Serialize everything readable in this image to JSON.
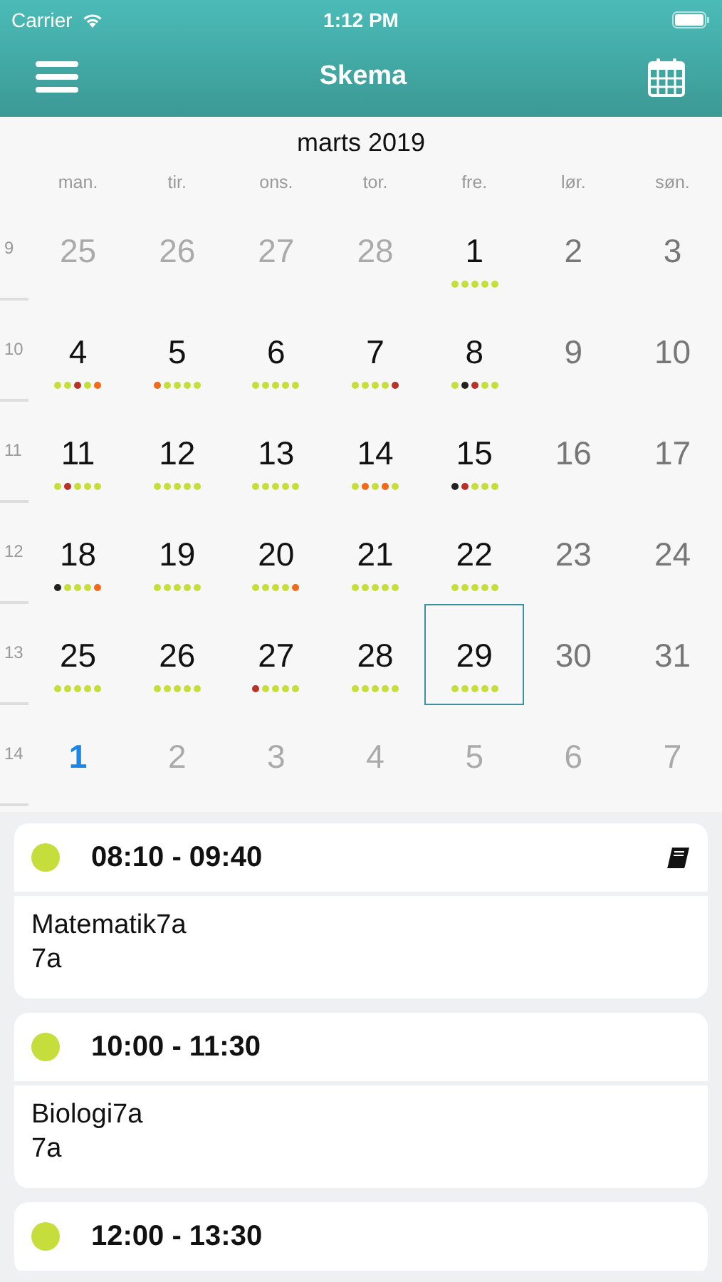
{
  "status_bar": {
    "carrier": "Carrier",
    "time": "1:12 PM"
  },
  "nav": {
    "title": "Skema"
  },
  "calendar": {
    "month": "marts 2019",
    "weekdays": [
      "man.",
      "tir.",
      "ons.",
      "tor.",
      "fre.",
      "lør.",
      "søn."
    ],
    "weeks": [
      {
        "number": "9",
        "days": [
          {
            "label": "25",
            "kind": "outside",
            "selected": false
          },
          {
            "label": "26",
            "kind": "outside",
            "selected": false
          },
          {
            "label": "27",
            "kind": "outside",
            "selected": false
          },
          {
            "label": "28",
            "kind": "outside",
            "selected": false
          },
          {
            "label": "1",
            "kind": "weekday",
            "selected": false,
            "dots": [
              {
                "color": "#c6de3c"
              },
              {
                "color": "#c6de3c"
              },
              {
                "color": "#c6de3c"
              },
              {
                "color": "#c6de3c"
              },
              {
                "color": "#c6de3c"
              }
            ]
          },
          {
            "label": "2",
            "kind": "weekend",
            "selected": false
          },
          {
            "label": "3",
            "kind": "weekend",
            "selected": false
          }
        ]
      },
      {
        "number": "10",
        "days": [
          {
            "label": "4",
            "kind": "weekday",
            "selected": false,
            "dots": [
              {
                "color": "#c6de3c"
              },
              {
                "color": "#c6de3c"
              },
              {
                "color": "#b8322a"
              },
              {
                "color": "#c6de3c"
              },
              {
                "color": "#f06a1c"
              }
            ]
          },
          {
            "label": "5",
            "kind": "weekday",
            "selected": false,
            "dots": [
              {
                "color": "#f06a1c"
              },
              {
                "color": "#c6de3c"
              },
              {
                "color": "#c6de3c"
              },
              {
                "color": "#c6de3c"
              },
              {
                "color": "#c6de3c"
              }
            ]
          },
          {
            "label": "6",
            "kind": "weekday",
            "selected": false,
            "dots": [
              {
                "color": "#c6de3c"
              },
              {
                "color": "#c6de3c"
              },
              {
                "color": "#c6de3c"
              },
              {
                "color": "#c6de3c"
              },
              {
                "color": "#c6de3c"
              }
            ]
          },
          {
            "label": "7",
            "kind": "weekday",
            "selected": false,
            "dots": [
              {
                "color": "#c6de3c"
              },
              {
                "color": "#c6de3c"
              },
              {
                "color": "#c6de3c"
              },
              {
                "color": "#c6de3c"
              },
              {
                "color": "#b8322a"
              }
            ]
          },
          {
            "label": "8",
            "kind": "weekday",
            "selected": false,
            "dots": [
              {
                "color": "#c6de3c"
              },
              {
                "color": "#222222"
              },
              {
                "color": "#b8322a"
              },
              {
                "color": "#c6de3c"
              },
              {
                "color": "#c6de3c"
              }
            ]
          },
          {
            "label": "9",
            "kind": "weekend",
            "selected": false
          },
          {
            "label": "10",
            "kind": "weekend",
            "selected": false
          }
        ]
      },
      {
        "number": "11",
        "days": [
          {
            "label": "11",
            "kind": "weekday",
            "selected": false,
            "dots": [
              {
                "color": "#c6de3c"
              },
              {
                "color": "#b8322a"
              },
              {
                "color": "#c6de3c"
              },
              {
                "color": "#c6de3c"
              },
              {
                "color": "#c6de3c"
              }
            ]
          },
          {
            "label": "12",
            "kind": "weekday",
            "selected": false,
            "dots": [
              {
                "color": "#c6de3c"
              },
              {
                "color": "#c6de3c"
              },
              {
                "color": "#c6de3c"
              },
              {
                "color": "#c6de3c"
              },
              {
                "color": "#c6de3c"
              }
            ]
          },
          {
            "label": "13",
            "kind": "weekday",
            "selected": false,
            "dots": [
              {
                "color": "#c6de3c"
              },
              {
                "color": "#c6de3c"
              },
              {
                "color": "#c6de3c"
              },
              {
                "color": "#c6de3c"
              },
              {
                "color": "#c6de3c"
              }
            ]
          },
          {
            "label": "14",
            "kind": "weekday",
            "selected": false,
            "dots": [
              {
                "color": "#c6de3c"
              },
              {
                "color": "#f06a1c"
              },
              {
                "color": "#c6de3c"
              },
              {
                "color": "#f06a1c"
              },
              {
                "color": "#c6de3c"
              }
            ]
          },
          {
            "label": "15",
            "kind": "weekday",
            "selected": false,
            "dots": [
              {
                "color": "#222222"
              },
              {
                "color": "#b8322a"
              },
              {
                "color": "#c6de3c"
              },
              {
                "color": "#c6de3c"
              },
              {
                "color": "#c6de3c"
              }
            ]
          },
          {
            "label": "16",
            "kind": "weekend",
            "selected": false
          },
          {
            "label": "17",
            "kind": "weekend",
            "selected": false
          }
        ]
      },
      {
        "number": "12",
        "days": [
          {
            "label": "18",
            "kind": "weekday",
            "selected": false,
            "dots": [
              {
                "color": "#222222"
              },
              {
                "color": "#c6de3c"
              },
              {
                "color": "#c6de3c"
              },
              {
                "color": "#c6de3c"
              },
              {
                "color": "#f06a1c"
              }
            ]
          },
          {
            "label": "19",
            "kind": "weekday",
            "selected": false,
            "dots": [
              {
                "color": "#c6de3c"
              },
              {
                "color": "#c6de3c"
              },
              {
                "color": "#c6de3c"
              },
              {
                "color": "#c6de3c"
              },
              {
                "color": "#c6de3c"
              }
            ]
          },
          {
            "label": "20",
            "kind": "weekday",
            "selected": false,
            "dots": [
              {
                "color": "#c6de3c"
              },
              {
                "color": "#c6de3c"
              },
              {
                "color": "#c6de3c"
              },
              {
                "color": "#c6de3c"
              },
              {
                "color": "#f06a1c"
              }
            ]
          },
          {
            "label": "21",
            "kind": "weekday",
            "selected": false,
            "dots": [
              {
                "color": "#c6de3c"
              },
              {
                "color": "#c6de3c"
              },
              {
                "color": "#c6de3c"
              },
              {
                "color": "#c6de3c"
              },
              {
                "color": "#c6de3c"
              }
            ]
          },
          {
            "label": "22",
            "kind": "weekday",
            "selected": false,
            "dots": [
              {
                "color": "#c6de3c"
              },
              {
                "color": "#c6de3c"
              },
              {
                "color": "#c6de3c"
              },
              {
                "color": "#c6de3c"
              },
              {
                "color": "#c6de3c"
              }
            ]
          },
          {
            "label": "23",
            "kind": "weekend",
            "selected": false
          },
          {
            "label": "24",
            "kind": "weekend",
            "selected": false
          }
        ]
      },
      {
        "number": "13",
        "days": [
          {
            "label": "25",
            "kind": "weekday",
            "selected": false,
            "dots": [
              {
                "color": "#c6de3c"
              },
              {
                "color": "#c6de3c"
              },
              {
                "color": "#c6de3c"
              },
              {
                "color": "#c6de3c"
              },
              {
                "color": "#c6de3c"
              }
            ]
          },
          {
            "label": "26",
            "kind": "weekday",
            "selected": false,
            "dots": [
              {
                "color": "#c6de3c"
              },
              {
                "color": "#c6de3c"
              },
              {
                "color": "#c6de3c"
              },
              {
                "color": "#c6de3c"
              },
              {
                "color": "#c6de3c"
              }
            ]
          },
          {
            "label": "27",
            "kind": "weekday",
            "selected": false,
            "dots": [
              {
                "color": "#b8322a"
              },
              {
                "color": "#c6de3c"
              },
              {
                "color": "#c6de3c"
              },
              {
                "color": "#c6de3c"
              },
              {
                "color": "#c6de3c"
              }
            ]
          },
          {
            "label": "28",
            "kind": "weekday",
            "selected": false,
            "dots": [
              {
                "color": "#c6de3c"
              },
              {
                "color": "#c6de3c"
              },
              {
                "color": "#c6de3c"
              },
              {
                "color": "#c6de3c"
              },
              {
                "color": "#c6de3c"
              }
            ]
          },
          {
            "label": "29",
            "kind": "weekday",
            "selected": true,
            "dots": [
              {
                "color": "#c6de3c"
              },
              {
                "color": "#c6de3c"
              },
              {
                "color": "#c6de3c"
              },
              {
                "color": "#c6de3c"
              },
              {
                "color": "#c6de3c"
              }
            ]
          },
          {
            "label": "30",
            "kind": "weekend",
            "selected": false
          },
          {
            "label": "31",
            "kind": "weekend",
            "selected": false
          }
        ]
      },
      {
        "number": "14",
        "days": [
          {
            "label": "1",
            "kind": "today",
            "selected": false
          },
          {
            "label": "2",
            "kind": "outside",
            "selected": false
          },
          {
            "label": "3",
            "kind": "outside",
            "selected": false
          },
          {
            "label": "4",
            "kind": "outside",
            "selected": false
          },
          {
            "label": "5",
            "kind": "outside",
            "selected": false
          },
          {
            "label": "6",
            "kind": "outside",
            "selected": false
          },
          {
            "label": "7",
            "kind": "outside",
            "selected": false
          }
        ]
      }
    ]
  },
  "lessons": [
    {
      "color": "#c6de3c",
      "time": "08:10 - 09:40",
      "homework": true,
      "lines": [
        "Matematik7a",
        "7a"
      ]
    },
    {
      "color": "#c6de3c",
      "time": "10:00 - 11:30",
      "homework": false,
      "lines": [
        "Biologi7a",
        "7a"
      ]
    },
    {
      "color": "#c6de3c",
      "time": "12:00 - 13:30",
      "homework": false
    }
  ]
}
